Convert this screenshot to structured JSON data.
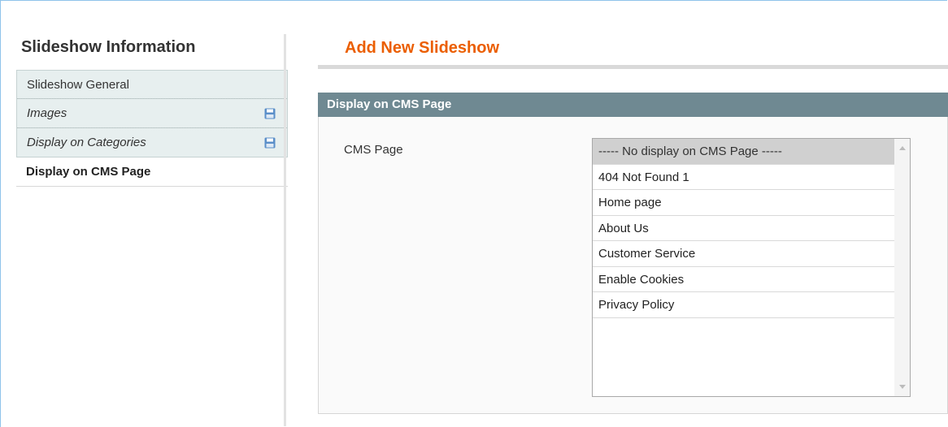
{
  "sidebar": {
    "title": "Slideshow Information",
    "tabs": [
      {
        "label": "Slideshow General",
        "icon": ""
      },
      {
        "label": "Images",
        "icon": "save-icon"
      },
      {
        "label": "Display on Categories",
        "icon": "save-icon"
      },
      {
        "label": "Display on CMS Page",
        "icon": ""
      }
    ]
  },
  "main": {
    "title": "Add New Slideshow",
    "section_title": "Display on CMS Page",
    "field": {
      "label": "CMS Page",
      "selected_index": 0,
      "options": [
        "----- No display on CMS Page -----",
        "404 Not Found 1",
        "Home page",
        "About Us",
        "Customer Service",
        "Enable Cookies",
        "Privacy Policy"
      ]
    }
  },
  "colors": {
    "accent": "#eb5e00",
    "section_header": "#6f8992",
    "tab_background": "#e7efef",
    "icon": "#5b8fc9"
  }
}
